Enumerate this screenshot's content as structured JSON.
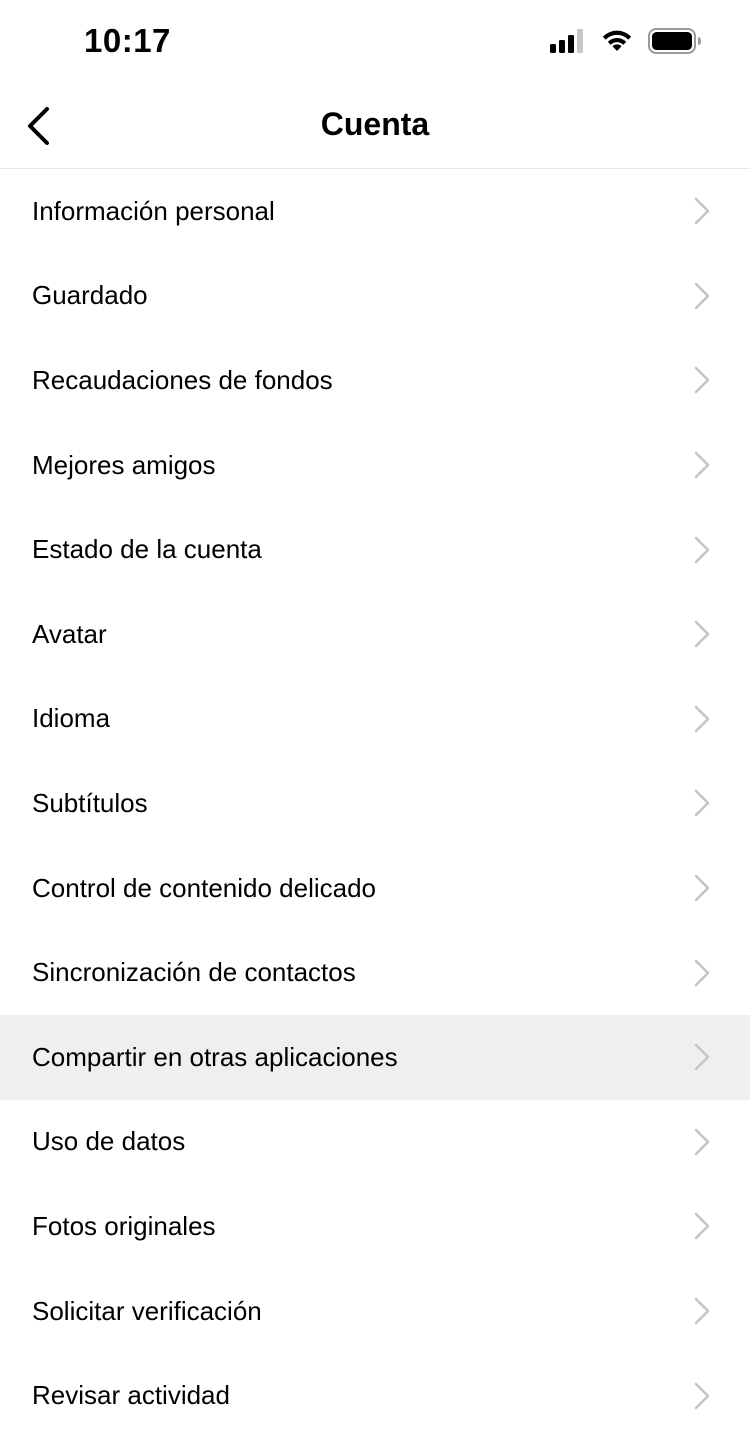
{
  "status_bar": {
    "time": "10:17",
    "icons": [
      "signal-icon",
      "wifi-icon",
      "battery-icon"
    ]
  },
  "nav": {
    "title": "Cuenta",
    "back_icon": "chevron-left-icon"
  },
  "menu": {
    "items": [
      {
        "label": "Información personal",
        "highlighted": false
      },
      {
        "label": "Guardado",
        "highlighted": false
      },
      {
        "label": "Recaudaciones de fondos",
        "highlighted": false
      },
      {
        "label": "Mejores amigos",
        "highlighted": false
      },
      {
        "label": "Estado de la cuenta",
        "highlighted": false
      },
      {
        "label": "Avatar",
        "highlighted": false
      },
      {
        "label": "Idioma",
        "highlighted": false
      },
      {
        "label": "Subtítulos",
        "highlighted": false
      },
      {
        "label": "Control de contenido delicado",
        "highlighted": false
      },
      {
        "label": "Sincronización de contactos",
        "highlighted": false
      },
      {
        "label": "Compartir en otras aplicaciones",
        "highlighted": true
      },
      {
        "label": "Uso de datos",
        "highlighted": false
      },
      {
        "label": "Fotos originales",
        "highlighted": false
      },
      {
        "label": "Solicitar verificación",
        "highlighted": false
      },
      {
        "label": "Revisar actividad",
        "highlighted": false
      }
    ],
    "chevron_icon": "chevron-right-icon",
    "chevron_color": "#c4c4c4",
    "highlight_color": "#efefef"
  }
}
